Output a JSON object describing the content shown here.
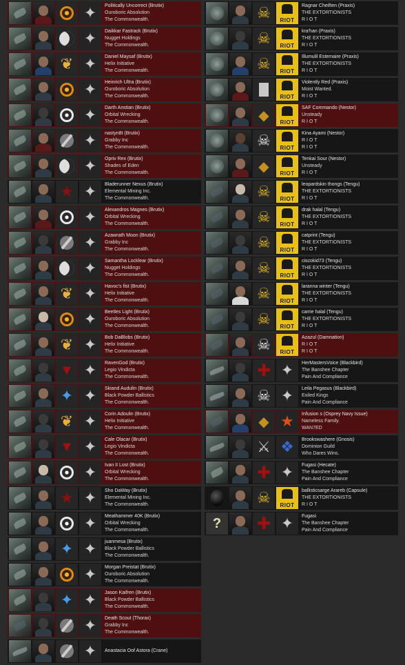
{
  "left": [
    {
      "name": "Politically Uncorrect (Brutix)",
      "corp": "Ouroboric Absolution",
      "alliance": "The Commonwealth.",
      "ship": "ship",
      "portrait": "portrait-red",
      "corp_icon": "orange",
      "alli_icon": "star",
      "row": "hl"
    },
    {
      "name": "Daikkar Fastrack (Brutix)",
      "corp": "Nugget Holdings",
      "alliance": "The Commonwealth.",
      "ship": "ship",
      "portrait": "portrait",
      "corp_icon": "crescent",
      "alli_icon": "star",
      "row": "hl"
    },
    {
      "name": "Daniel Maysaf (Brutix)",
      "corp": "Helix Initiative",
      "alliance": "The Commonwealth.",
      "ship": "ship",
      "portrait": "portrait-blue",
      "corp_icon": "bird",
      "alli_icon": "star",
      "row": "hl"
    },
    {
      "name": "Heinrich Ultra (Brutix)",
      "corp": "Ouroboric Absolution",
      "alliance": "The Commonwealth.",
      "ship": "ship",
      "portrait": "portrait",
      "corp_icon": "orange",
      "alli_icon": "star",
      "row": "hl"
    },
    {
      "name": "Darth Anstian (Brutix)",
      "corp": "Orbital Wrecking",
      "alliance": "The Commonwealth.",
      "ship": "ship",
      "portrait": "portrait-shadow",
      "corp_icon": "ring",
      "alli_icon": "star",
      "row": "hl"
    },
    {
      "name": "nastyn8t (Brutix)",
      "corp": "Grabby Inc",
      "alliance": "The Commonwealth.",
      "ship": "ship",
      "portrait": "portrait-red",
      "corp_icon": "grab",
      "alli_icon": "star",
      "row": "hl"
    },
    {
      "name": "Opriv Rex (Brutix)",
      "corp": "Shades of Eden",
      "alliance": "The Commonwealth.",
      "ship": "ship",
      "portrait": "portrait",
      "corp_icon": "crescent",
      "alli_icon": "star",
      "row": "hl"
    },
    {
      "name": "Bladerunner Nexus (Brutix)",
      "corp": "Elemental Mining Inc.",
      "alliance": "The Commonwealth.",
      "ship": "ship",
      "portrait": "portrait",
      "corp_icon": "redstar",
      "alli_icon": "star",
      "row": "dk"
    },
    {
      "name": "Alexandros Magnes (Brutix)",
      "corp": "Orbital Wrecking",
      "alliance": "The Commonwealth.",
      "ship": "ship",
      "portrait": "portrait-red",
      "corp_icon": "ring",
      "alli_icon": "star",
      "row": "hl"
    },
    {
      "name": "Azawrath Moon (Brutix)",
      "corp": "Grabby Inc",
      "alliance": "The Commonwealth.",
      "ship": "ship",
      "portrait": "portrait-shadow",
      "corp_icon": "grab",
      "alli_icon": "star",
      "row": "hl"
    },
    {
      "name": "Samantha Locklear (Brutix)",
      "corp": "Nugget Holdings",
      "alliance": "The Commonwealth.",
      "ship": "ship",
      "portrait": "portrait",
      "corp_icon": "crescent",
      "alli_icon": "star",
      "row": "hl"
    },
    {
      "name": "Havoc's fist (Brutix)",
      "corp": "Helix Initiative",
      "alliance": "The Commonwealth.",
      "ship": "ship",
      "portrait": "portrait",
      "corp_icon": "bird",
      "alli_icon": "star",
      "row": "hl"
    },
    {
      "name": "Beetles Light (Brutix)",
      "corp": "Ouroboric Absolution",
      "alliance": "The Commonwealth.",
      "ship": "ship",
      "portrait": "portrait-pale",
      "corp_icon": "orange",
      "alli_icon": "star",
      "row": "hl"
    },
    {
      "name": "Bob DaBlobs (Brutix)",
      "corp": "Helix Initiative",
      "alliance": "The Commonwealth.",
      "ship": "ship",
      "portrait": "portrait",
      "corp_icon": "bird",
      "alli_icon": "star",
      "row": "hl"
    },
    {
      "name": "RavenGod (Brutix)",
      "corp": "Legio Vindicta",
      "alliance": "The Commonwealth.",
      "ship": "ship",
      "portrait": "portrait-shadow",
      "corp_icon": "redv",
      "alli_icon": "star",
      "row": "hl"
    },
    {
      "name": "Skiand Audulin (Brutix)",
      "corp": "Black Powder Ballistics",
      "alliance": "The Commonwealth.",
      "ship": "ship",
      "portrait": "portrait",
      "corp_icon": "blue",
      "alli_icon": "star",
      "row": "hl"
    },
    {
      "name": "Corin Adoulin (Brutix)",
      "corp": "Helix Initiative",
      "alliance": "The Commonwealth.",
      "ship": "ship",
      "portrait": "portrait-shadow",
      "corp_icon": "bird",
      "alli_icon": "star",
      "row": "hl"
    },
    {
      "name": "Cale Olacar (Brutix)",
      "corp": "Legio Vindicta",
      "alliance": "The Commonwealth.",
      "ship": "ship",
      "portrait": "portrait-shadow",
      "corp_icon": "redv",
      "alli_icon": "star",
      "row": "hl"
    },
    {
      "name": "Ivan II Lost (Brutix)",
      "corp": "Orbital Wrecking",
      "alliance": "The Commonwealth.",
      "ship": "ship",
      "portrait": "portrait-pale",
      "corp_icon": "ring",
      "alli_icon": "star",
      "row": "hl"
    },
    {
      "name": "Sho DaWay (Brutix)",
      "corp": "Elemental Mining Inc.",
      "alliance": "The Commonwealth.",
      "ship": "ship",
      "portrait": "portrait",
      "corp_icon": "redstar",
      "alli_icon": "star",
      "row": "dk"
    },
    {
      "name": "Meathammer 40K (Brutix)",
      "corp": "Orbital Wrecking",
      "alliance": "The Commonwealth.",
      "ship": "ship",
      "portrait": "portrait",
      "corp_icon": "ring",
      "alli_icon": "star",
      "row": "dk"
    },
    {
      "name": "juanmesa (Brutix)",
      "corp": "Black Powder Ballistics",
      "alliance": "The Commonwealth.",
      "ship": "ship",
      "portrait": "portrait",
      "corp_icon": "blue",
      "alli_icon": "star",
      "row": "dk"
    },
    {
      "name": "Morgan Preistat (Brutix)",
      "corp": "Ouroboric Absolution",
      "alliance": "The Commonwealth.",
      "ship": "ship",
      "portrait": "portrait",
      "corp_icon": "orange",
      "alli_icon": "star",
      "row": "dk"
    },
    {
      "name": "Jason Kaifren (Brutix)",
      "corp": "Black Powder Ballistics",
      "alliance": "The Commonwealth.",
      "ship": "ship",
      "portrait": "portrait-shadow",
      "corp_icon": "blue",
      "alli_icon": "star",
      "row": "hl"
    },
    {
      "name": "Death Scout (Thorax)",
      "corp": "Grabby Inc",
      "alliance": "The Commonwealth.",
      "ship": "ship-dark",
      "portrait": "portrait-shadow",
      "corp_icon": "grab",
      "alli_icon": "star",
      "row": "hl"
    },
    {
      "name": "Anastacia Oof Astora (Crane)",
      "corp": "",
      "alliance": "",
      "ship": "ship-frig",
      "portrait": "portrait",
      "corp_icon": "grab",
      "alli_icon": "star",
      "row": "dk"
    }
  ],
  "right": [
    {
      "name": "Ragnar Cheiften (Praxis)",
      "corp": "THE EXTORTIONISTS",
      "alliance": "R I O T",
      "ship": "ship-round",
      "portrait": "portrait",
      "corp_icon": "skull",
      "alli_icon": "riot",
      "row": "dk"
    },
    {
      "name": "kra'han (Praxis)",
      "corp": "THE EXTORTIONISTS",
      "alliance": "R I O T",
      "ship": "ship-round",
      "portrait": "portrait-shadow",
      "corp_icon": "skull",
      "alli_icon": "riot",
      "row": "dk"
    },
    {
      "name": "Illumulil Estemaire (Praxis)",
      "corp": "THE EXTORTIONISTS",
      "alliance": "R I O T",
      "ship": "ship-round",
      "portrait": "portrait-blue",
      "corp_icon": "skull",
      "alli_icon": "riot",
      "row": "dk"
    },
    {
      "name": "Violently Red (Praxis)",
      "corp": "Moist Wanted.",
      "alliance": "R I O T",
      "ship": "ship-round",
      "portrait": "portrait-red",
      "corp_icon": "box",
      "alli_icon": "riot",
      "row": "dk"
    },
    {
      "name": "SAF Commando (Nestor)",
      "corp": "Unsteady",
      "alliance": "R I O T",
      "ship": "ship-round",
      "portrait": "portrait",
      "corp_icon": "tower",
      "alli_icon": "riot",
      "row": "hl"
    },
    {
      "name": "Kina Ayami (Nestor)",
      "corp": "R I O T",
      "alliance": "R I O T",
      "ship": "ship-round",
      "portrait": "portrait-dark",
      "corp_icon": "skullw",
      "alli_icon": "riot",
      "row": "dk"
    },
    {
      "name": "Tenkai Sour (Nestor)",
      "corp": "Unsteady",
      "alliance": "R I O T",
      "ship": "ship-round",
      "portrait": "portrait-red",
      "corp_icon": "tower",
      "alli_icon": "riot",
      "row": "dk"
    },
    {
      "name": "leopardskin thongs (Tengu)",
      "corp": "THE EXTORTIONISTS",
      "alliance": "R I O T",
      "ship": "ship-dark",
      "portrait": "portrait-pale",
      "corp_icon": "skull",
      "alli_icon": "riot",
      "row": "dk"
    },
    {
      "name": "drak halal (Tengu)",
      "corp": "THE EXTORTIONISTS",
      "alliance": "R I O T",
      "ship": "ship-dark",
      "portrait": "portrait",
      "corp_icon": "skull",
      "alli_icon": "riot",
      "row": "dk"
    },
    {
      "name": "catprint (Tengu)",
      "corp": "THE EXTORTIONISTS",
      "alliance": "R I O T",
      "ship": "ship-dark",
      "portrait": "portrait-shadow",
      "corp_icon": "skull",
      "alli_icon": "riot",
      "row": "dk"
    },
    {
      "name": "ciscokid73 (Tengu)",
      "corp": "THE EXTORTIONISTS",
      "alliance": "R I O T",
      "ship": "ship-dark",
      "portrait": "portrait",
      "corp_icon": "skull",
      "alli_icon": "riot",
      "row": "dk"
    },
    {
      "name": "laranna winter (Tengu)",
      "corp": "THE EXTORTIONISTS",
      "alliance": "R I O T",
      "ship": "ship-dark",
      "portrait": "portrait-white",
      "corp_icon": "skull",
      "alli_icon": "riot",
      "row": "dk"
    },
    {
      "name": "carrie halal (Tengu)",
      "corp": "THE EXTORTIONISTS",
      "alliance": "R I O T",
      "ship": "ship-dark",
      "portrait": "portrait-shadow",
      "corp_icon": "skull",
      "alli_icon": "riot",
      "row": "dk"
    },
    {
      "name": "Azazul (Damnation)",
      "corp": "R I O T",
      "alliance": "R I O T",
      "ship": "ship-dark",
      "portrait": "portrait",
      "corp_icon": "skullw",
      "alli_icon": "riot",
      "row": "hl"
    },
    {
      "name": "HerMastersVoice (Blackbird)",
      "corp": "The Banshee Chapter",
      "alliance": "Pain And Compliance",
      "ship": "ship-frig",
      "portrait": "portrait-shadow",
      "corp_icon": "cross",
      "alli_icon": "star",
      "row": "dk"
    },
    {
      "name": "Leila Pegasus (Blackbird)",
      "corp": "Exiled Kings",
      "alliance": "Pain And Compliance",
      "ship": "ship-frig",
      "portrait": "portrait",
      "corp_icon": "skullw",
      "alli_icon": "star",
      "row": "dk"
    },
    {
      "name": "Infusion s (Osprey Navy Issue)",
      "corp": "Nameless Family.",
      "alliance": "WAN7ED",
      "ship": "ship-dark",
      "portrait": "portrait-blue",
      "corp_icon": "tower",
      "alli_icon": "dragon",
      "row": "hl"
    },
    {
      "name": "Brookswashere (Gnosis)",
      "corp": "Dominion Guild",
      "alliance": "Who Dares Wins.",
      "ship": "ship-frig",
      "portrait": "portrait-shadow",
      "corp_icon": "sab",
      "alli_icon": "dominion",
      "row": "dk"
    },
    {
      "name": "Fugasi (Hecate)",
      "corp": "The Banshee Chapter",
      "alliance": "Pain And Compliance",
      "ship": "ship",
      "portrait": "portrait",
      "corp_icon": "cross",
      "alli_icon": "star",
      "row": "dk"
    },
    {
      "name": "ballisticsarge Arareb (Capsule)",
      "corp": "THE EXTORTIONISTS",
      "alliance": "R I O T",
      "ship": "ship-egg",
      "portrait": "portrait",
      "corp_icon": "skull",
      "alli_icon": "riot",
      "row": "dk"
    },
    {
      "name": "Fugasi",
      "corp": "The Banshee Chapter",
      "alliance": "Pain And Compliance",
      "ship": "ship-q",
      "portrait": "portrait",
      "corp_icon": "cross",
      "alli_icon": "star",
      "row": "dk"
    }
  ],
  "riot_label": "RIOT"
}
